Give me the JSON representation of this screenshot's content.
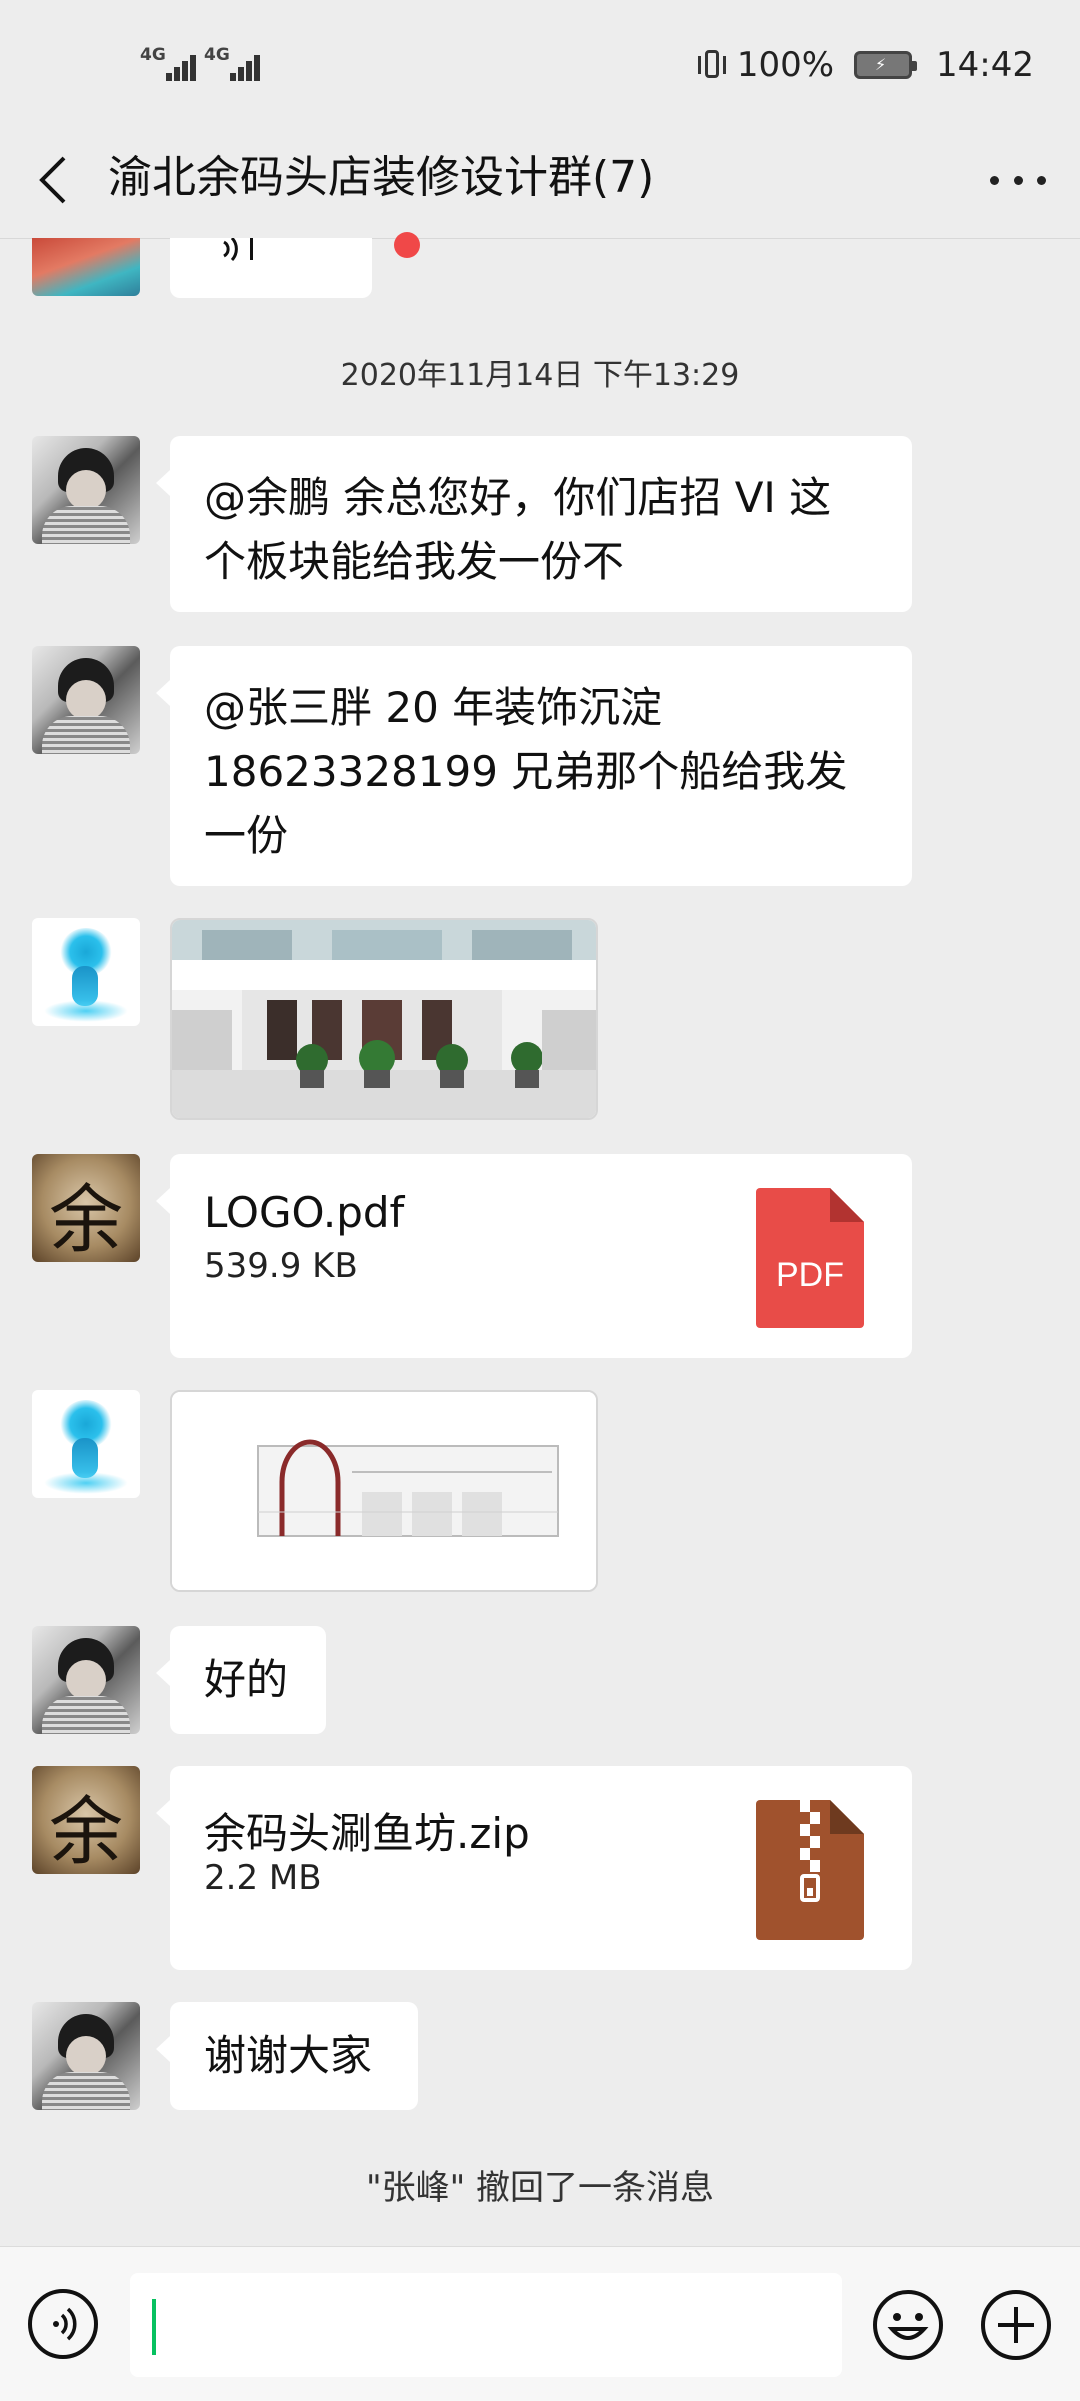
{
  "status_bar": {
    "sim1": "4G",
    "sim2": "4G",
    "battery_percent": "100%",
    "time": "14:42"
  },
  "header": {
    "title": "渝北余码头店装修设计群(7)"
  },
  "timestamp": "2020年11月14日 下午13:29",
  "messages": [
    {
      "type": "text",
      "text": "@余鹏  余总您好，你们店招 VI 这\n个板块能给我发一份不"
    },
    {
      "type": "text",
      "text": "@张三胖 20 年装饰沉淀\n18623328199  兄弟那个船给我发\n一份"
    },
    {
      "type": "image"
    },
    {
      "type": "file",
      "name": "LOGO.pdf",
      "size": "539.9 KB",
      "icon_label": "PDF",
      "icon_color": "#e84c48"
    },
    {
      "type": "image"
    },
    {
      "type": "text",
      "text": "好的"
    },
    {
      "type": "file",
      "name": "余码头涮鱼坊.zip",
      "size": "2.2 MB",
      "icon_color": "#a0522d"
    },
    {
      "type": "text",
      "text": "谢谢大家"
    }
  ],
  "system_notice": "\"张峰\" 撤回了一条消息",
  "avatar_glyph": "余",
  "icons": [
    "back-icon",
    "more-icon",
    "voice-icon",
    "emoji-icon",
    "plus-icon"
  ],
  "colors": {
    "caret": "#07c160",
    "background": "#ededed",
    "bubble": "#ffffff",
    "unread_dot": "#f04848"
  }
}
